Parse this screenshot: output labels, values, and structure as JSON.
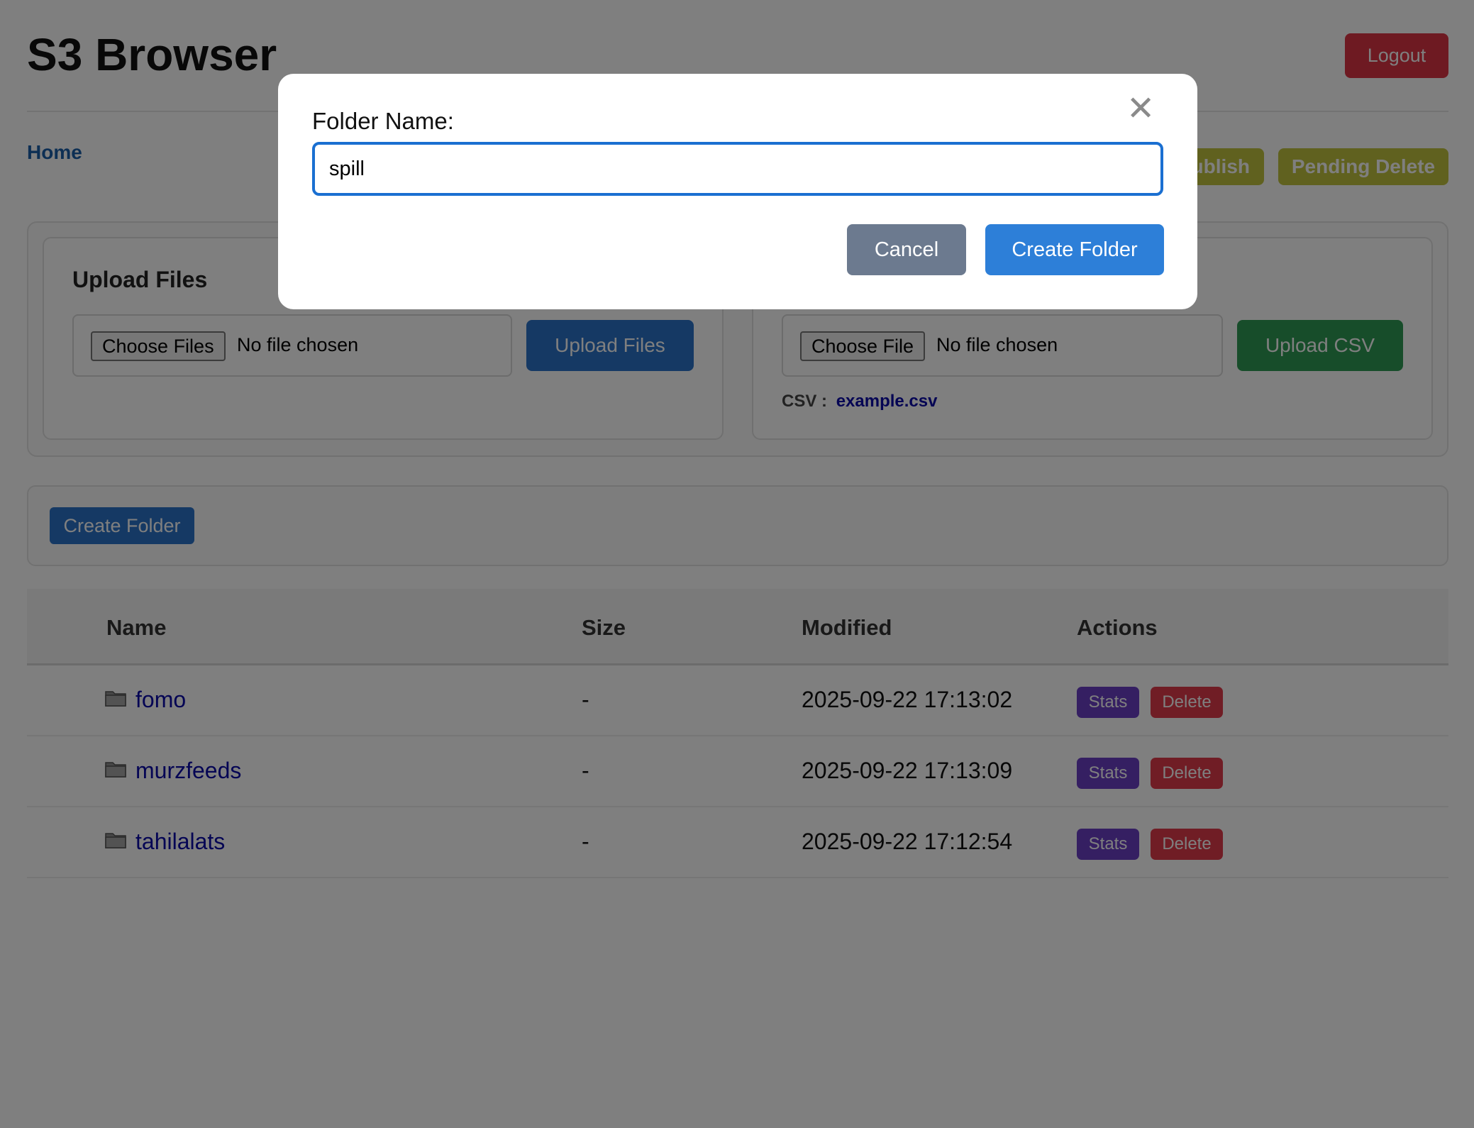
{
  "header": {
    "title": "S3 Browser",
    "logout_label": "Logout"
  },
  "breadcrumb": {
    "home_label": "Home"
  },
  "status_buttons": {
    "publish_label": "Publish",
    "pending_delete_label": "Pending Delete"
  },
  "upload_files": {
    "title": "Upload Files",
    "choose_label": "Choose Files",
    "no_file_text": "No file chosen",
    "upload_label": "Upload Files"
  },
  "upload_csv": {
    "choose_label": "Choose File",
    "no_file_text": "No file chosen",
    "upload_label": "Upload CSV",
    "hint_label": "CSV :",
    "hint_link": "example.csv"
  },
  "folder_bar": {
    "create_label": "Create Folder"
  },
  "table": {
    "columns": [
      "Name",
      "Size",
      "Modified",
      "Actions"
    ],
    "rows": [
      {
        "name": "fomo",
        "size": "-",
        "modified": "2025-09-22 17:13:02"
      },
      {
        "name": "murzfeeds",
        "size": "-",
        "modified": "2025-09-22 17:13:09"
      },
      {
        "name": "tahilalats",
        "size": "-",
        "modified": "2025-09-22 17:12:54"
      }
    ],
    "stats_label": "Stats",
    "delete_label": "Delete"
  },
  "modal": {
    "label": "Folder Name:",
    "input_value": "spill",
    "close_glyph": "✕",
    "cancel_label": "Cancel",
    "create_label": "Create Folder"
  },
  "colors": {
    "primary": "#2a72c8",
    "danger": "#dc3545",
    "success": "#2e9a55",
    "warning": "#c1c23e",
    "stats": "#6a3fc4"
  }
}
